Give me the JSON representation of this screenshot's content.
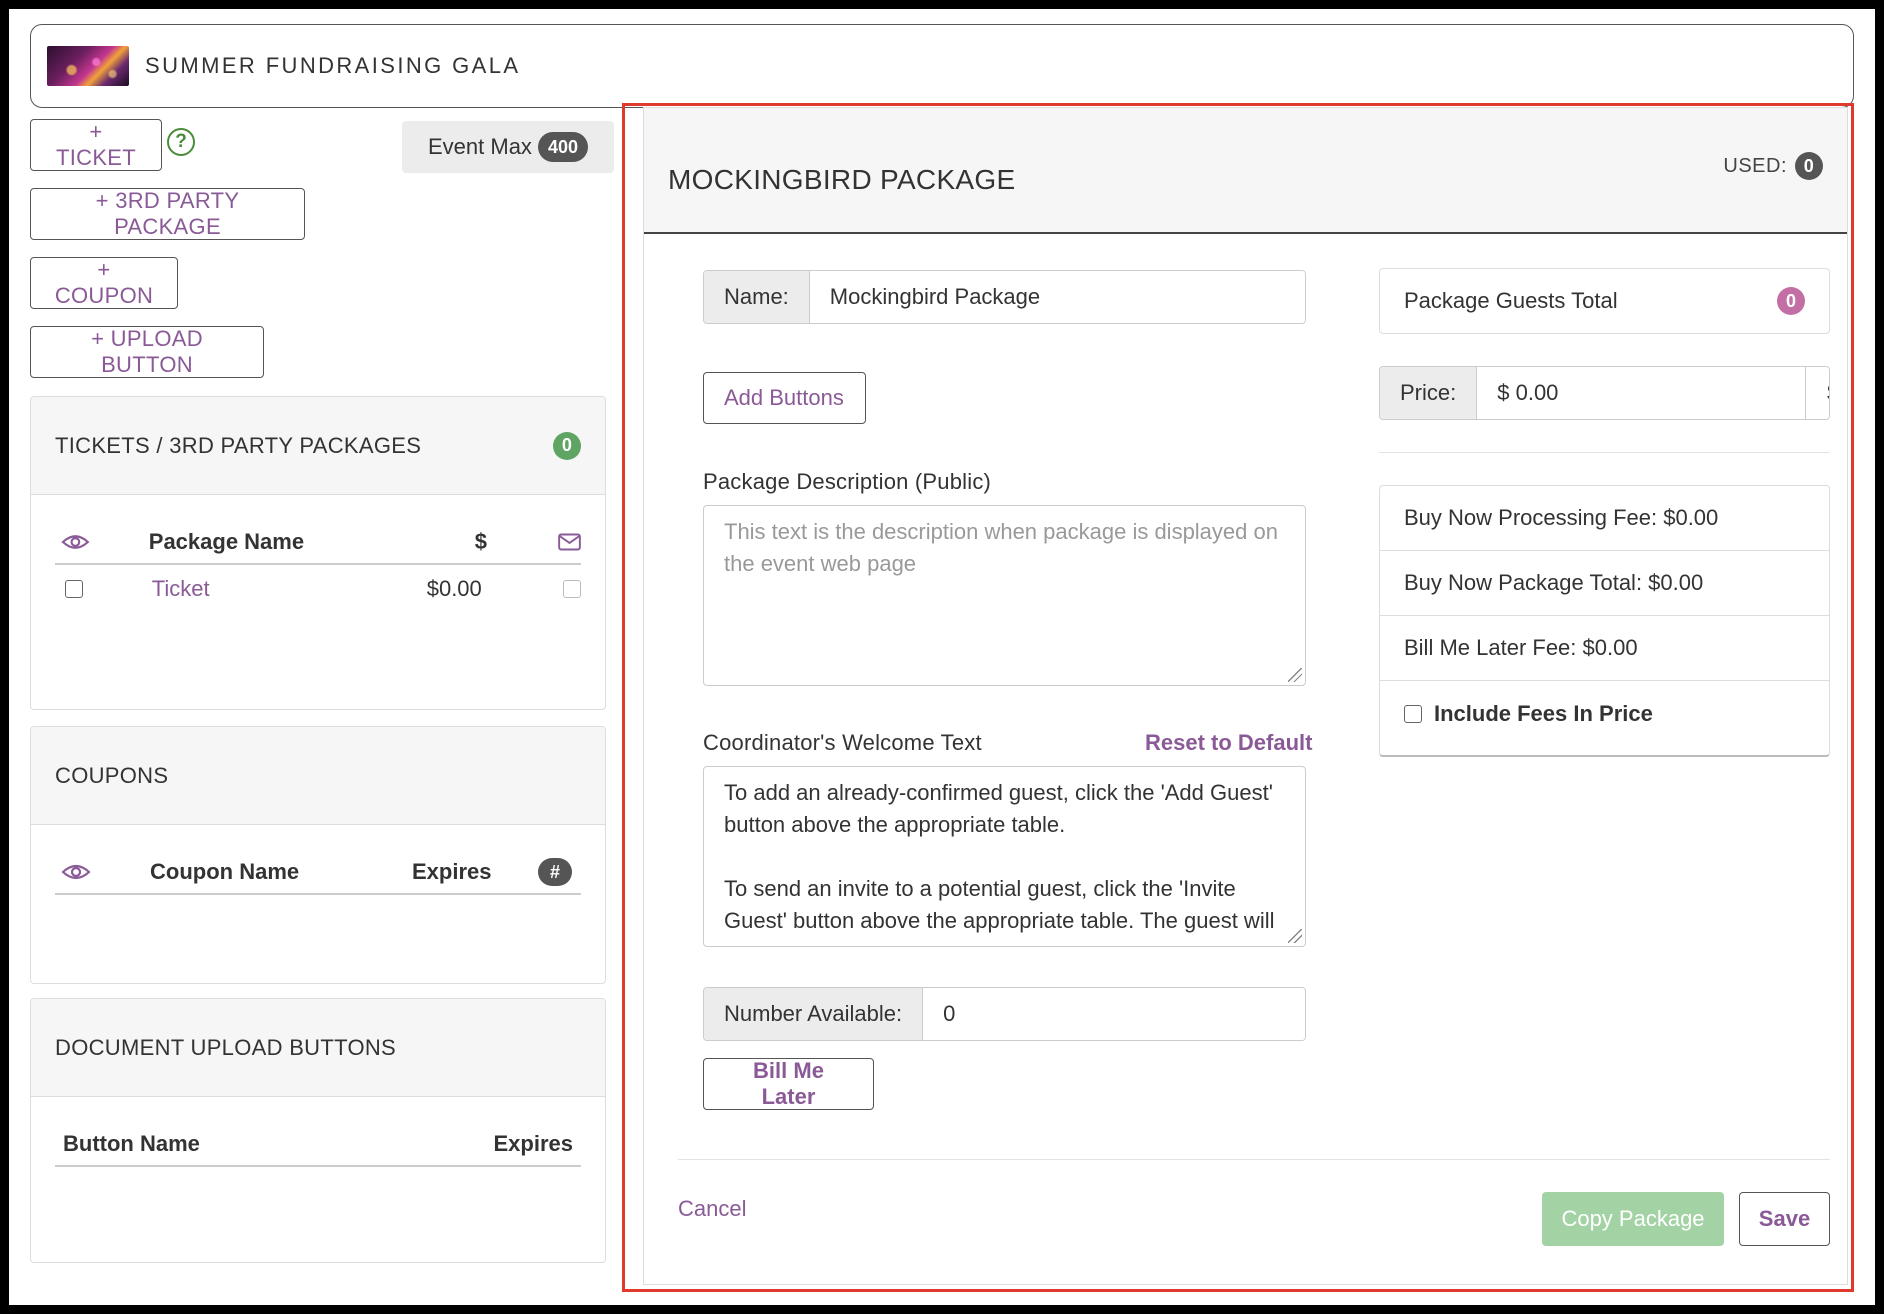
{
  "event": {
    "title": "SUMMER FUNDRAISING GALA"
  },
  "left": {
    "buttons": {
      "ticket": "+ TICKET",
      "third_party": "+ 3RD PARTY PACKAGE",
      "coupon": "+ COUPON",
      "upload": "+ UPLOAD BUTTON"
    },
    "help_icon": "?",
    "event_max": {
      "label": "Event Max",
      "value": "400"
    },
    "tickets_panel": {
      "title": "TICKETS / 3RD PARTY PACKAGES",
      "count": "0",
      "headers": {
        "name": "Package Name",
        "price": "$"
      },
      "rows": [
        {
          "name": "Ticket",
          "price": "$0.00"
        }
      ]
    },
    "coupons_panel": {
      "title": "COUPONS",
      "headers": {
        "name": "Coupon Name",
        "expires": "Expires",
        "count": "#"
      }
    },
    "uploads_panel": {
      "title": "DOCUMENT UPLOAD BUTTONS",
      "headers": {
        "name": "Button Name",
        "expires": "Expires"
      }
    }
  },
  "editor": {
    "title": "MOCKINGBIRD PACKAGE",
    "used_label": "USED:",
    "used_count": "0",
    "name_label": "Name:",
    "name_value": "Mockingbird Package",
    "add_buttons": "Add Buttons",
    "description_label": "Package Description (Public)",
    "description_placeholder": "This text is the description when package is displayed on the event web page",
    "welcome_label": "Coordinator's Welcome Text",
    "reset_default": "Reset to Default",
    "welcome_para1": "To add an already-confirmed guest, click the 'Add Guest' button above the appropriate table.",
    "welcome_para2": "To send an invite to a potential guest, click the 'Invite Guest' button above the appropriate table. The guest will",
    "number_label": "Number Available:",
    "number_value": "0",
    "bill_me_later": "Bill Me Later",
    "guests_total_label": "Package Guests Total",
    "guests_total": "0",
    "price_label": "Price:",
    "price_value": "$ 0.00",
    "price_set": "Set",
    "fees": {
      "processing": "Buy Now Processing Fee: $0.00",
      "package_total": "Buy Now Package Total: $0.00",
      "bill_later_fee": "Bill Me Later Fee: $0.00",
      "include_fees": "Include Fees In Price"
    },
    "cancel": "Cancel",
    "copy": "Copy Package",
    "save": "Save"
  },
  "colors": {
    "accent": "#8a5a97",
    "highlight_frame": "#e03a2f",
    "success_light": "#a3d3a5",
    "badge_green": "#5fa463",
    "badge_pink": "#c36fa6"
  }
}
